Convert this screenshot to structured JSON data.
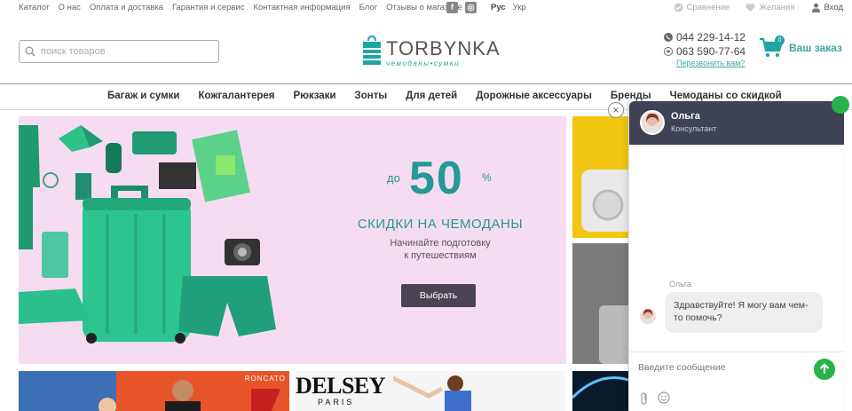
{
  "topbar": {
    "links": [
      "Каталог",
      "О нас",
      "Оплата и доставка",
      "Гарантия и сервис",
      "Контактная информация",
      "Блог",
      "Отзывы о магазине"
    ],
    "lang_active": "Рус",
    "lang_other": "Укр",
    "compare": "Сравнение",
    "wishlist": "Желания",
    "login": "Вход"
  },
  "header": {
    "search_placeholder": "поиск товаров",
    "logo_word": "TORBYNKA",
    "logo_sub": "чемоданы•сумки",
    "phone1": "044 229-14-12",
    "phone2": "063 590-77-64",
    "callback": "Перезвонить вам?",
    "cart_label": "Ваш заказ",
    "cart_count": "0"
  },
  "nav": [
    "Багаж и сумки",
    "Кожгалантерея",
    "Рюкзаки",
    "Зонты",
    "Для детей",
    "Дорожные аксессуары",
    "Бренды",
    "Чемоданы со скидкой"
  ],
  "hero": {
    "prefix": "до",
    "percent": "50",
    "sign": "%",
    "title": "СКИДКИ НА ЧЕМОДАНЫ",
    "subtitle_line1": "Начинайте подготовку",
    "subtitle_line2": "к путешествиям",
    "button": "Выбрать"
  },
  "banners": {
    "b1_brand": "RONCATO",
    "b2_brand": "DELSEY",
    "b2_city": "PARIS"
  },
  "chat": {
    "agent_name": "Ольга",
    "agent_role": "Консультант",
    "msg_author": "Ольга",
    "msg_text": "Здравствуйте! Я могу вам чем-то помочь?",
    "input_placeholder": "Введите сообщение",
    "close_glyph": "×"
  },
  "colors": {
    "accent": "#1fa5a0",
    "hero_bg": "#f6dcf0",
    "chat_header": "#3d4254",
    "send_button": "#27b24a"
  }
}
